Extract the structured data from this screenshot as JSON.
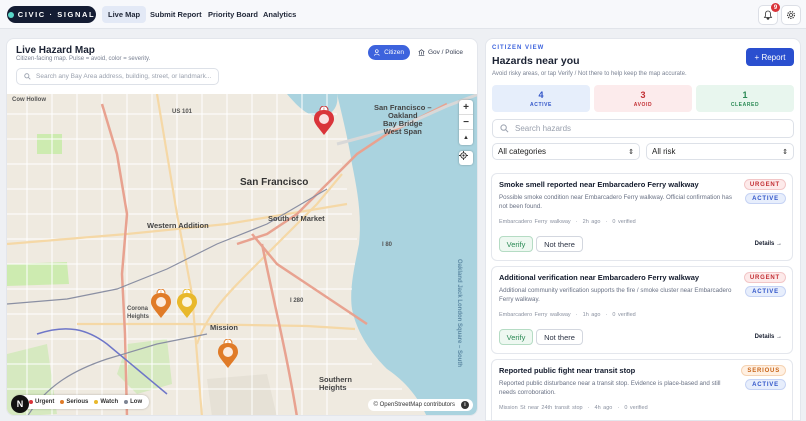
{
  "nav": {
    "brand": "CIVIC · SIGNAL",
    "items": [
      {
        "label": "Live Map",
        "active": true
      },
      {
        "label": "Submit Report",
        "active": false
      },
      {
        "label": "Priority Board",
        "active": false
      },
      {
        "label": "Analytics",
        "active": false
      }
    ],
    "notification_count": "9"
  },
  "map_panel": {
    "title": "Live Hazard Map",
    "subtitle": "Citizen-facing map. Pulse = avoid, color = severity.",
    "view_toggle": {
      "citizen": "Citizen",
      "gov": "Gov / Police"
    },
    "search_placeholder": "Search any Bay Area address, building, street, or landmark...",
    "labels": {
      "sf": "San Francisco",
      "som": "South of Market",
      "wa": "Western Addition",
      "mission": "Mission",
      "us101": "US 101",
      "bridge": "San Francisco –\nOakland\nBay Bridge\nWest Span",
      "i80": "I 80",
      "twin": "Corona\nHeights",
      "sh": "Southern\nHeights",
      "i280": "I 280",
      "i80b": "I 80",
      "oakland_sq": "Oakland Jack London Square – South"
    },
    "legend": [
      {
        "label": "Urgent",
        "color": "#d9343a"
      },
      {
        "label": "Serious",
        "color": "#e07b28"
      },
      {
        "label": "Watch",
        "color": "#e8b82b"
      },
      {
        "label": "Low",
        "color": "#7c8493"
      }
    ],
    "controls": {
      "zoom_in": "+",
      "zoom_out": "−",
      "compass": "▲"
    },
    "attribution": "© OpenStreetMap contributors",
    "logo": "N"
  },
  "hazard_panel": {
    "eyebrow": "CITIZEN VIEW",
    "title": "Hazards near you",
    "subtitle": "Avoid risky areas, or tap Verify / Not there to help keep the map accurate.",
    "report_button": "+ Report",
    "stats": [
      {
        "value": "4",
        "label": "ACTIVE",
        "bg": "#e6eefb",
        "color": "#3054c8"
      },
      {
        "value": "3",
        "label": "AVOID",
        "bg": "#fcebec",
        "color": "#c22e33"
      },
      {
        "value": "1",
        "label": "CLEARED",
        "bg": "#e8f6ee",
        "color": "#2b8a55"
      }
    ],
    "search_placeholder": "Search hazards",
    "category_select": "All categories",
    "risk_select": "All risk",
    "cards": [
      {
        "title": "Smoke smell reported near Embarcadero Ferry walkway",
        "desc": "Possible smoke condition near Embarcadero Ferry walkway. Official confirmation has not been found.",
        "location": "Embarcadero Ferry walkway",
        "age": "2h ago",
        "verified": "0 verified",
        "severity": "URGENT",
        "status": "ACTIVE",
        "verify": "Verify",
        "not_there": "Not there",
        "details": "Details →"
      },
      {
        "title": "Additional verification near Embarcadero Ferry walkway",
        "desc": "Additional community verification supports the fire / smoke cluster near Embarcadero Ferry walkway.",
        "location": "Embarcadero Ferry walkway",
        "age": "1h ago",
        "verified": "0 verified",
        "severity": "URGENT",
        "status": "ACTIVE",
        "verify": "Verify",
        "not_there": "Not there",
        "details": "Details →"
      },
      {
        "title": "Reported public fight near transit stop",
        "desc": "Reported public disturbance near a transit stop. Evidence is place-based and still needs corroboration.",
        "location": "Mission St near 24th transit stop",
        "age": "4h ago",
        "verified": "0 verified",
        "severity": "SERIOUS",
        "status": "ACTIVE"
      }
    ]
  },
  "colors": {
    "accent": "#3d63dd",
    "urgent": "#d9343a",
    "serious": "#e07b28",
    "watch": "#e8b82b"
  }
}
